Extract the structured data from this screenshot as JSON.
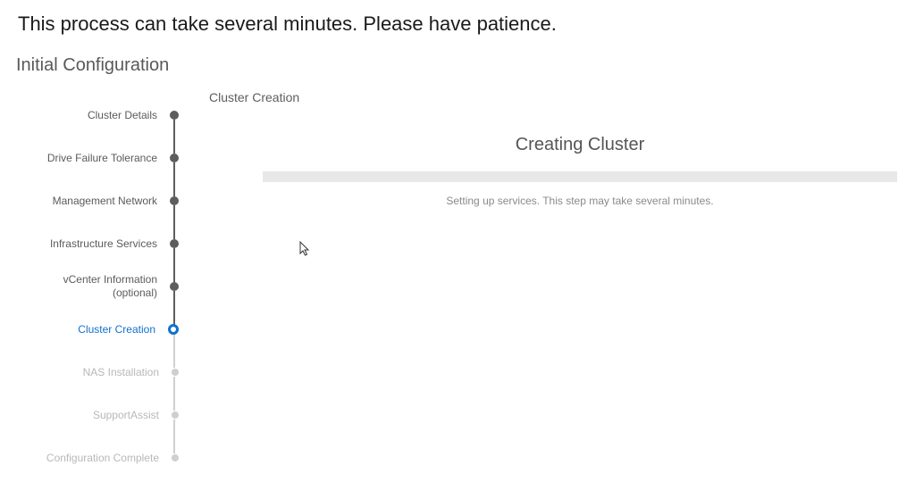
{
  "caption": "This process can take several minutes. Please have patience.",
  "page_title": "Initial Configuration",
  "section_title": "Cluster Creation",
  "steps": [
    {
      "label": "Cluster Details",
      "state": "done"
    },
    {
      "label": "Drive Failure Tolerance",
      "state": "done"
    },
    {
      "label": "Management Network",
      "state": "done"
    },
    {
      "label": "Infrastructure Services",
      "state": "done"
    },
    {
      "label": "vCenter Information (optional)",
      "state": "done"
    },
    {
      "label": "Cluster Creation",
      "state": "active"
    },
    {
      "label": "NAS Installation",
      "state": "pending"
    },
    {
      "label": "SupportAssist",
      "state": "pending"
    },
    {
      "label": "Configuration Complete",
      "state": "pending"
    }
  ],
  "progress": {
    "title": "Creating Cluster",
    "status": "Setting up services. This step may take several minutes."
  }
}
